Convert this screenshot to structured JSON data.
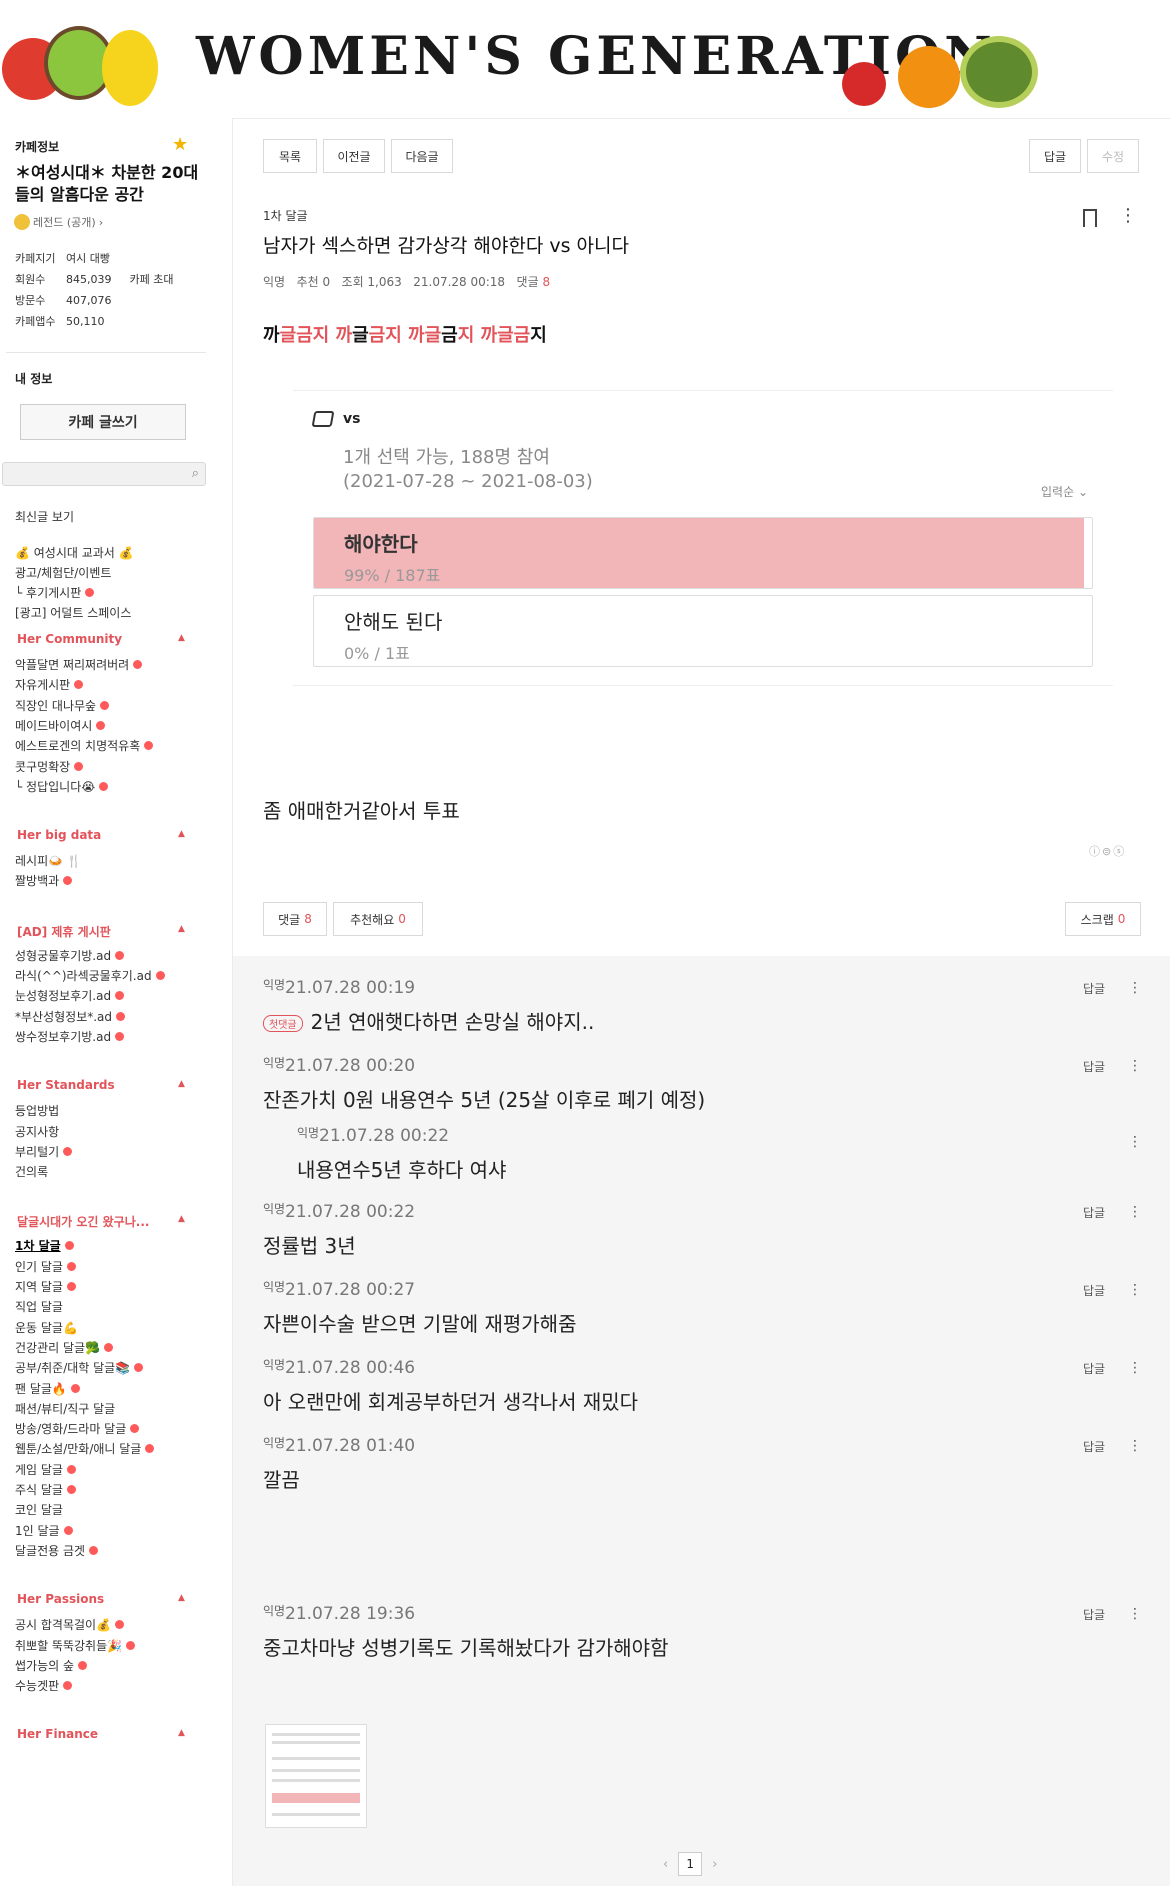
{
  "banner": {
    "title": "WOMEN'S GENERATION"
  },
  "sidebar": {
    "cafe_info_label": "카페정보",
    "cafe_name": "＊여성시대＊ 차분한 20대들의 알흠다운 공간",
    "level": "레전드 (공개)",
    "stats": [
      {
        "key": "카페지기",
        "value": "여시 대빵",
        "extra": ""
      },
      {
        "key": "회원수",
        "value": "845,039",
        "extra": "카페 초대"
      },
      {
        "key": "방문수",
        "value": "407,076",
        "extra": ""
      },
      {
        "key": "카페앱수",
        "value": "50,110",
        "extra": ""
      }
    ],
    "my_info_label": "내 정보",
    "write_label": "카페 글쓰기",
    "menu_top": [
      "최신글 보기"
    ],
    "menu_group0": [
      "💰 여성시대 교과서 💰",
      "광고/체험단/이벤트",
      "└ 후기게시판",
      "[광고] 어덜트 스페이스"
    ],
    "categories": [
      {
        "name": "Her Community",
        "items": [
          "악플달면 쩌리쩌려버려",
          "자유게시판",
          "직장인 대나무숲",
          "메이드바이여시",
          "에스트로겐의 치명적유혹",
          "콧구멍확장",
          "└ 정답입니다😭"
        ]
      },
      {
        "name": "Her big data",
        "items": [
          "레시피🍛 🍴",
          "짤방백과"
        ]
      },
      {
        "name": "[AD] 제휴 게시판",
        "items": [
          "성형궁물후기방.ad",
          "라식(^^)라섹궁물후기.ad",
          "눈성형정보후기.ad",
          "*부산성형정보*.ad",
          "쌍수정보후기방.ad"
        ]
      },
      {
        "name": "Her Standards",
        "items": [
          "등업방법",
          "공지사항",
          "부리털기",
          "건의록"
        ]
      },
      {
        "name": "달글시대가 오긴 왔구나...",
        "items": [
          "1차 달글",
          "인기 달글",
          "지역 달글",
          "직업 달글",
          "운동 달글💪",
          "건강관리 달글🥦",
          "공부/취준/대학 달글📚",
          "팬 달글🔥",
          "패션/뷰티/직구 달글",
          "방송/영화/드라마 달글",
          "웹툰/소설/만화/애니 달글",
          "게임 달글",
          "주식 달글",
          "코인 달글",
          "1인 달글",
          "달글전용 금겟"
        ]
      },
      {
        "name": "Her Passions",
        "items": [
          "공시 합격목걸이💰",
          "취뽀할 뚝뚝강취들🎉",
          "썹가능의 숲",
          "수능겟판"
        ]
      },
      {
        "name": "Her Finance",
        "items": []
      }
    ]
  },
  "toolbar": {
    "list": "목록",
    "prev": "이전글",
    "next": "다음글",
    "reply": "답글",
    "edit": "수정"
  },
  "post": {
    "board": "1차 달글",
    "title": "남자가 섹스하면 감가상각 해야한다 vs 아니다",
    "meta_author": "익명",
    "meta_recommend": "추천 0",
    "meta_views": "조회 1,063",
    "meta_date": "21.07.28 00:18",
    "meta_comments_label": "댓글",
    "meta_comments_count": "8",
    "highlight_parts": [
      {
        "t": "까",
        "c": "blk"
      },
      {
        "t": "글금지 ",
        "c": "red"
      },
      {
        "t": "까",
        "c": "red"
      },
      {
        "t": "글",
        "c": "blk"
      },
      {
        "t": "금지 ",
        "c": "red"
      },
      {
        "t": "까글",
        "c": "red"
      },
      {
        "t": "금",
        "c": "blk"
      },
      {
        "t": "지 ",
        "c": "red"
      },
      {
        "t": "까글금",
        "c": "red"
      },
      {
        "t": "지",
        "c": "blk"
      }
    ],
    "poll": {
      "title": "vs",
      "info": "1개 선택 가능, 188명 참여",
      "period": "(2021-07-28 ~ 2021-08-03)",
      "sort": "입력순",
      "options": [
        {
          "label": "해야한다",
          "count": "99% / 187표",
          "fraction": 0.99
        },
        {
          "label": "안해도 된다",
          "count": "0% / 1표",
          "fraction": 0.0
        }
      ]
    },
    "body": "좀 애매한거같아서 투표",
    "actions": {
      "comment": "댓글",
      "comment_count": "8",
      "like": "추천해요",
      "like_count": "0",
      "scrap": "스크랩",
      "scrap_count": "0"
    }
  },
  "comments": {
    "reply_label": "답글",
    "first_badge": "첫댓글",
    "items": [
      {
        "author": "익명",
        "time": "21.07.28 00:19",
        "text": "2년 연애햇다하면 손망실 해야지..",
        "first": true
      },
      {
        "author": "익명",
        "time": "21.07.28 00:20",
        "text": "잔존가치 0원 내용연수 5년 (25살 이후로 폐기 예정)"
      },
      {
        "author": "익명",
        "time": "21.07.28 00:22",
        "text": "내용연수5년 후하다 여샤",
        "reply": true
      },
      {
        "author": "익명",
        "time": "21.07.28 00:22",
        "text": "정률법 3년"
      },
      {
        "author": "익명",
        "time": "21.07.28 00:27",
        "text": "자쁜이수술 받으면 기말에 재평가해줌"
      },
      {
        "author": "익명",
        "time": "21.07.28 00:46",
        "text": "아 오랜만에 회계공부하던거 생각나서 재밌다"
      },
      {
        "author": "익명",
        "time": "21.07.28 01:40",
        "text": "깔끔",
        "image": true
      },
      {
        "author": "익명",
        "time": "21.07.28 19:36",
        "text": "중고차마냥 성병기록도 기록해놨다가 감가해야함"
      }
    ],
    "page": "1"
  }
}
